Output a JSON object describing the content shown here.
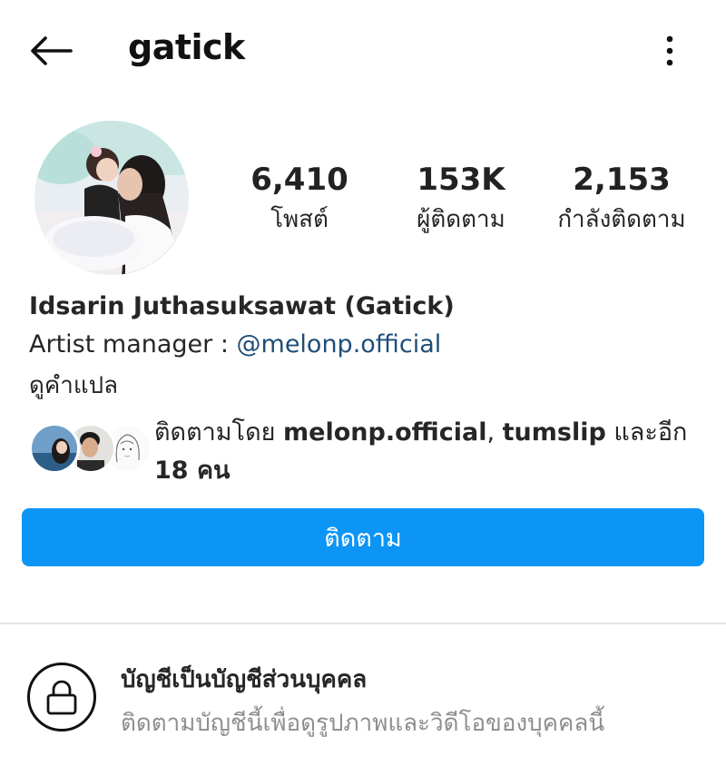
{
  "header": {
    "username": "gatick",
    "back_icon": "arrow-left-icon",
    "more_icon": "more-vertical-icon"
  },
  "profile": {
    "stats": {
      "posts": {
        "value": "6,410",
        "label": "โพสต์"
      },
      "followers": {
        "value": "153K",
        "label": "ผู้ติดตาม"
      },
      "following": {
        "value": "2,153",
        "label": "กำลังติดตาม"
      }
    },
    "full_name": "Idsarin Juthasuksawat (Gatick)",
    "bio_prefix": "Artist manager : ",
    "bio_mention": "@melonp.official",
    "translate_link": "ดูคำแปล"
  },
  "followed_by": {
    "prefix": "ติดตามโดย ",
    "user1": "melonp.official",
    "separator": ", ",
    "user2": "tumslip",
    "more_prefix": " และอีก ",
    "more_count": "18",
    "more_suffix": " คน"
  },
  "follow_button": {
    "label": "ติดตาม"
  },
  "private_notice": {
    "icon": "lock-icon",
    "title": "บัญชีเป็นบัญชีส่วนบุคคล",
    "description": "ติดตามบัญชีนี้เพื่อดูรูปภาพและวิดีโอของบุคคลนี้"
  },
  "colors": {
    "primary_button": "#0d95f6",
    "mention": "#1f4e79",
    "secondary_text": "#8e8e8e"
  }
}
